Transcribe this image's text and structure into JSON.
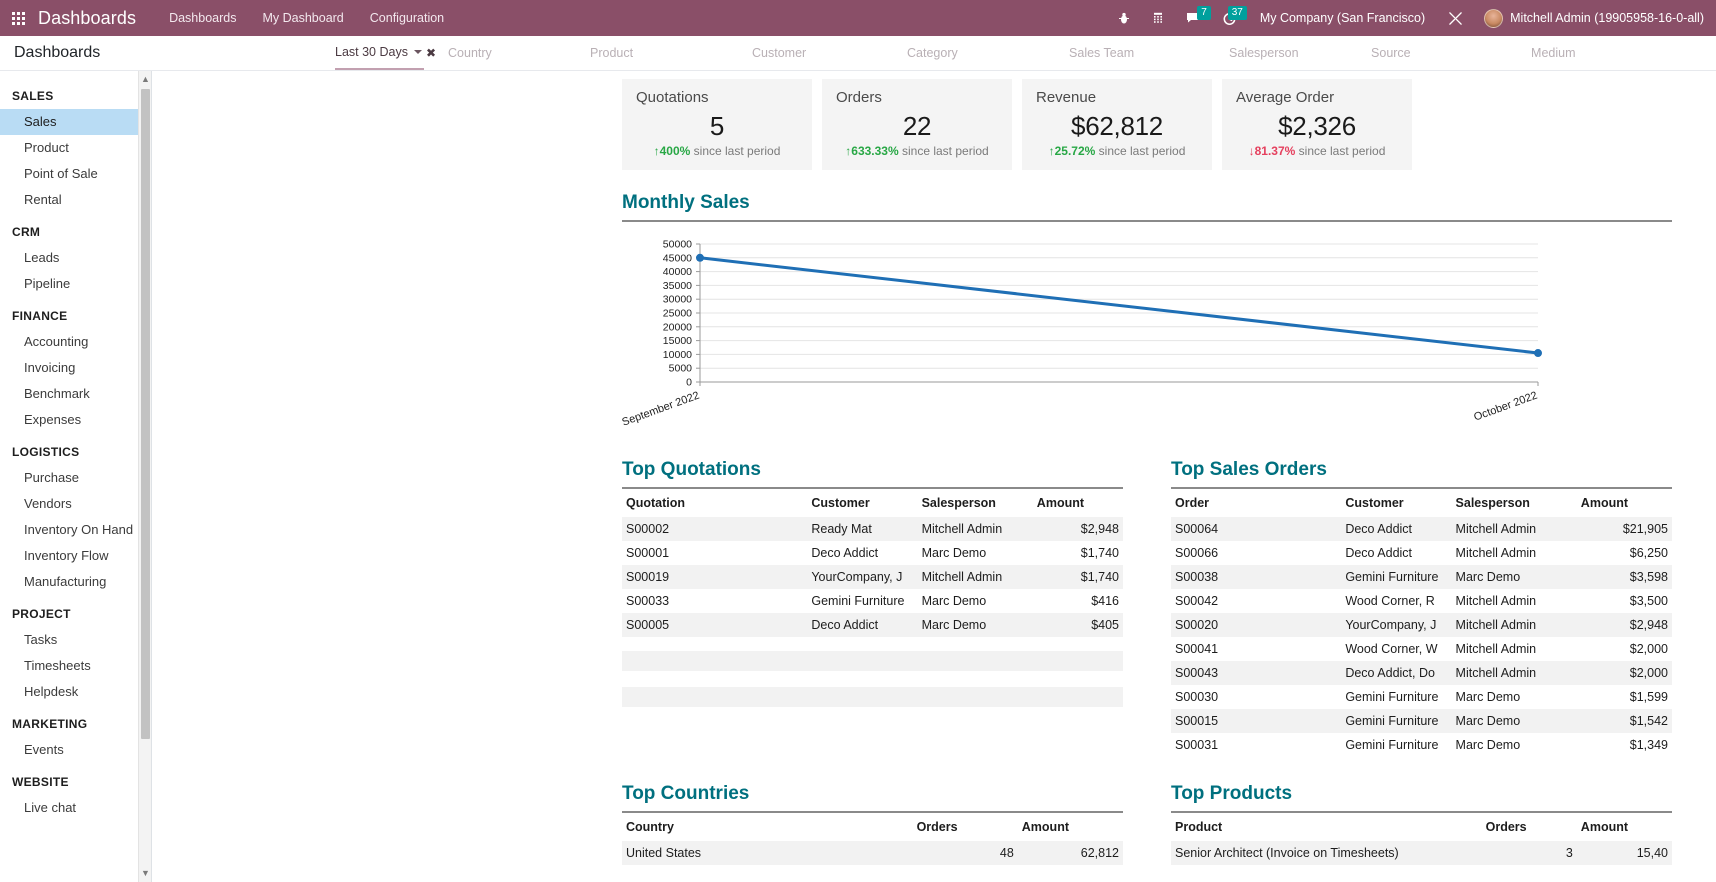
{
  "navbar": {
    "apps_icon": "apps-grid-icon",
    "brand": "Dashboards",
    "menu": [
      {
        "label": "Dashboards"
      },
      {
        "label": "My Dashboard"
      },
      {
        "label": "Configuration"
      }
    ],
    "sys_icons": [
      {
        "name": "bug-icon",
        "glyph": "⚙",
        "badge": ""
      },
      {
        "name": "phone-icon",
        "glyph": "☎",
        "badge": ""
      },
      {
        "name": "messages-icon",
        "glyph": "💬",
        "badge": "7"
      },
      {
        "name": "activities-clock-icon",
        "glyph": "⏱",
        "badge": "37"
      }
    ],
    "company": "My Company (San Francisco)",
    "debug_icon": "tools-icon",
    "user": "Mitchell Admin (19905958-16-0-all)",
    "accent": "#8a4f68",
    "badge_color": "#00a09d"
  },
  "controlbar": {
    "page_title": "Dashboards",
    "active_filter": "Last 30 Days",
    "clear_glyph": "✖",
    "filters": [
      {
        "label": "Country"
      },
      {
        "label": "Product"
      },
      {
        "label": "Customer"
      },
      {
        "label": "Category"
      },
      {
        "label": "Sales Team"
      },
      {
        "label": "Salesperson"
      },
      {
        "label": "Source"
      },
      {
        "label": "Medium"
      }
    ]
  },
  "sidebar": {
    "groups": [
      {
        "title": "SALES",
        "items": [
          {
            "label": "Sales",
            "active": true
          },
          {
            "label": "Product"
          },
          {
            "label": "Point of Sale"
          },
          {
            "label": "Rental"
          }
        ]
      },
      {
        "title": "CRM",
        "items": [
          {
            "label": "Leads"
          },
          {
            "label": "Pipeline"
          }
        ]
      },
      {
        "title": "FINANCE",
        "items": [
          {
            "label": "Accounting"
          },
          {
            "label": "Invoicing"
          },
          {
            "label": "Benchmark"
          },
          {
            "label": "Expenses"
          }
        ]
      },
      {
        "title": "LOGISTICS",
        "items": [
          {
            "label": "Purchase"
          },
          {
            "label": "Vendors"
          },
          {
            "label": "Inventory On Hand"
          },
          {
            "label": "Inventory Flow"
          },
          {
            "label": "Manufacturing"
          }
        ]
      },
      {
        "title": "PROJECT",
        "items": [
          {
            "label": "Tasks"
          },
          {
            "label": "Timesheets"
          },
          {
            "label": "Helpdesk"
          }
        ]
      },
      {
        "title": "MARKETING",
        "items": [
          {
            "label": "Events"
          }
        ]
      },
      {
        "title": "WEBSITE",
        "items": [
          {
            "label": "Live chat"
          }
        ]
      }
    ],
    "scroll_up_glyph": "▲",
    "scroll_down_glyph": "▼"
  },
  "kpis": [
    {
      "title": "Quotations",
      "value": "5",
      "delta": "400%",
      "direction": "up",
      "suffix": "since last period"
    },
    {
      "title": "Orders",
      "value": "22",
      "delta": "633.33%",
      "direction": "up",
      "suffix": "since last period"
    },
    {
      "title": "Revenue",
      "value": "$62,812",
      "delta": "25.72%",
      "direction": "up",
      "suffix": "since last period"
    },
    {
      "title": "Average Order",
      "value": "$2,326",
      "delta": "81.37%",
      "direction": "down",
      "suffix": "since last period"
    }
  ],
  "chart_data": {
    "type": "line",
    "title": "Monthly Sales",
    "x": [
      "September 2022",
      "October 2022"
    ],
    "series": [
      {
        "name": "Monthly Sales",
        "values": [
          45000,
          10500
        ],
        "color": "#1f6fb5"
      }
    ],
    "ylim": [
      0,
      50000
    ],
    "yticks": [
      0,
      5000,
      10000,
      15000,
      20000,
      25000,
      30000,
      35000,
      40000,
      45000,
      50000
    ],
    "ytick_labels": [
      "0",
      "5000",
      "10000",
      "15000",
      "20000",
      "25000",
      "30000",
      "35000",
      "40000",
      "45000",
      "50000"
    ],
    "xlabel": "",
    "ylabel": "",
    "grid": true,
    "legend": "none",
    "xtick_rotation": -20
  },
  "top_quotations": {
    "title": "Top Quotations",
    "columns": [
      "Quotation",
      "Customer",
      "Salesperson",
      "Amount"
    ],
    "rows": [
      {
        "quotation": "S00002",
        "customer": "Ready Mat",
        "salesperson": "Mitchell Admin",
        "amount": "$2,948"
      },
      {
        "quotation": "S00001",
        "customer": "Deco Addict",
        "salesperson": "Marc Demo",
        "amount": "$1,740"
      },
      {
        "quotation": "S00019",
        "customer": "YourCompany, J",
        "salesperson": "Mitchell Admin",
        "amount": "$1,740"
      },
      {
        "quotation": "S00033",
        "customer": "Gemini Furniture",
        "salesperson": "Marc Demo",
        "amount": "$416"
      },
      {
        "quotation": "S00005",
        "customer": "Deco Addict",
        "salesperson": "Marc Demo",
        "amount": "$405"
      }
    ]
  },
  "top_sales_orders": {
    "title": "Top Sales Orders",
    "columns": [
      "Order",
      "Customer",
      "Salesperson",
      "Amount"
    ],
    "rows": [
      {
        "order": "S00064",
        "customer": "Deco Addict",
        "salesperson": "Mitchell Admin",
        "amount": "$21,905"
      },
      {
        "order": "S00066",
        "customer": "Deco Addict",
        "salesperson": "Mitchell Admin",
        "amount": "$6,250"
      },
      {
        "order": "S00038",
        "customer": "Gemini Furniture",
        "salesperson": "Marc Demo",
        "amount": "$3,598"
      },
      {
        "order": "S00042",
        "customer": "Wood Corner, R",
        "salesperson": "Mitchell Admin",
        "amount": "$3,500"
      },
      {
        "order": "S00020",
        "customer": "YourCompany, J",
        "salesperson": "Mitchell Admin",
        "amount": "$2,948"
      },
      {
        "order": "S00041",
        "customer": "Wood Corner, W",
        "salesperson": "Mitchell Admin",
        "amount": "$2,000"
      },
      {
        "order": "S00043",
        "customer": "Deco Addict, Do",
        "salesperson": "Mitchell Admin",
        "amount": "$2,000"
      },
      {
        "order": "S00030",
        "customer": "Gemini Furniture",
        "salesperson": "Marc Demo",
        "amount": "$1,599"
      },
      {
        "order": "S00015",
        "customer": "Gemini Furniture",
        "salesperson": "Marc Demo",
        "amount": "$1,542"
      },
      {
        "order": "S00031",
        "customer": "Gemini Furniture",
        "salesperson": "Marc Demo",
        "amount": "$1,349"
      }
    ]
  },
  "top_countries": {
    "title": "Top Countries",
    "columns": [
      "Country",
      "Orders",
      "Amount"
    ],
    "rows": [
      {
        "country": "United States",
        "orders": "48",
        "amount": "62,812"
      }
    ]
  },
  "top_products": {
    "title": "Top Products",
    "columns": [
      "Product",
      "Orders",
      "Amount"
    ],
    "rows": [
      {
        "product": "Senior Architect (Invoice on Timesheets)",
        "orders": "3",
        "amount": "15,40"
      }
    ]
  }
}
